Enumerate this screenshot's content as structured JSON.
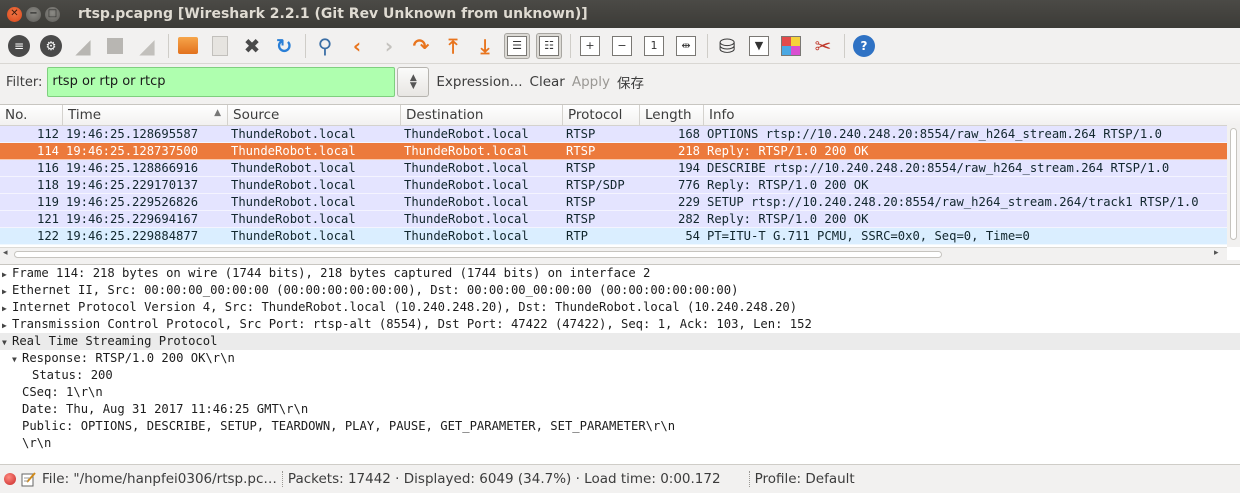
{
  "window": {
    "title": "rtsp.pcapng [Wireshark 2.2.1 (Git Rev Unknown from unknown)]"
  },
  "toolbar": {
    "icons": [
      "interfaces-icon",
      "options-icon",
      "start-capture-icon",
      "stop-capture-icon",
      "restart-capture-icon",
      "open-file-icon",
      "save-file-icon",
      "close-file-icon",
      "reload-icon",
      "find-icon",
      "go-back-icon",
      "go-forward-icon",
      "go-to-packet-icon",
      "go-first-icon",
      "go-last-icon",
      "autoscroll-icon",
      "colorize-icon",
      "zoom-in-icon",
      "zoom-out-icon",
      "normal-size-icon",
      "resize-columns-icon",
      "capture-filters-icon",
      "display-filters-icon",
      "coloring-rules-icon",
      "preferences-icon",
      "help-icon"
    ]
  },
  "filter": {
    "label": "Filter:",
    "value": "rtsp or rtp or rtcp",
    "expression": "Expression...",
    "clear": "Clear",
    "apply": "Apply",
    "save": "保存",
    "color": "#afffaf"
  },
  "packet_list": {
    "columns": [
      "No.",
      "Time",
      "Source",
      "Destination",
      "Protocol",
      "Length",
      "Info"
    ],
    "selected_color": "#ec7a3c",
    "rows": [
      {
        "no": "112",
        "time": "19:46:25.128695587",
        "src": "ThundeRobot.local",
        "dst": "ThundeRobot.local",
        "proto": "RTSP",
        "len": "168",
        "info": "OPTIONS rtsp://10.240.248.20:8554/raw_h264_stream.264 RTSP/1.0",
        "bg": "#e4e4ff",
        "selected": false
      },
      {
        "no": "114",
        "time": "19:46:25.128737500",
        "src": "ThundeRobot.local",
        "dst": "ThundeRobot.local",
        "proto": "RTSP",
        "len": "218",
        "info": "Reply: RTSP/1.0 200 OK",
        "bg": "#ec7a3c",
        "selected": true
      },
      {
        "no": "116",
        "time": "19:46:25.128866916",
        "src": "ThundeRobot.local",
        "dst": "ThundeRobot.local",
        "proto": "RTSP",
        "len": "194",
        "info": "DESCRIBE rtsp://10.240.248.20:8554/raw_h264_stream.264 RTSP/1.0",
        "bg": "#e4e4ff",
        "selected": false
      },
      {
        "no": "118",
        "time": "19:46:25.229170137",
        "src": "ThundeRobot.local",
        "dst": "ThundeRobot.local",
        "proto": "RTSP/SDP",
        "len": "776",
        "info": "Reply: RTSP/1.0 200 OK",
        "bg": "#e4e4ff",
        "selected": false
      },
      {
        "no": "119",
        "time": "19:46:25.229526826",
        "src": "ThundeRobot.local",
        "dst": "ThundeRobot.local",
        "proto": "RTSP",
        "len": "229",
        "info": "SETUP rtsp://10.240.248.20:8554/raw_h264_stream.264/track1 RTSP/1.0",
        "bg": "#e4e4ff",
        "selected": false
      },
      {
        "no": "121",
        "time": "19:46:25.229694167",
        "src": "ThundeRobot.local",
        "dst": "ThundeRobot.local",
        "proto": "RTSP",
        "len": "282",
        "info": "Reply: RTSP/1.0 200 OK",
        "bg": "#e4e4ff",
        "selected": false
      },
      {
        "no": "122",
        "time": "19:46:25.229884877",
        "src": "ThundeRobot.local",
        "dst": "ThundeRobot.local",
        "proto": "RTP",
        "len": "54",
        "info": "PT=ITU-T G.711 PCMU, SSRC=0x0, Seq=0, Time=0",
        "bg": "#daeeff",
        "selected": false
      }
    ]
  },
  "details": [
    {
      "text": "Frame 114: 218 bytes on wire (1744 bits), 218 bytes captured (1744 bits) on interface 2",
      "level": 0,
      "toggle": "collapsed",
      "hl": false
    },
    {
      "text": "Ethernet II, Src: 00:00:00_00:00:00 (00:00:00:00:00:00), Dst: 00:00:00_00:00:00 (00:00:00:00:00:00)",
      "level": 0,
      "toggle": "collapsed",
      "hl": false
    },
    {
      "text": "Internet Protocol Version 4, Src: ThundeRobot.local (10.240.248.20), Dst: ThundeRobot.local (10.240.248.20)",
      "level": 0,
      "toggle": "collapsed",
      "hl": false
    },
    {
      "text": "Transmission Control Protocol, Src Port: rtsp-alt (8554), Dst Port: 47422 (47422), Seq: 1, Ack: 103, Len: 152",
      "level": 0,
      "toggle": "collapsed",
      "hl": false
    },
    {
      "text": "Real Time Streaming Protocol",
      "level": 0,
      "toggle": "expanded",
      "hl": true
    },
    {
      "text": "Response: RTSP/1.0 200 OK\\r\\n",
      "level": 1,
      "toggle": "expanded",
      "hl": false
    },
    {
      "text": "Status: 200",
      "level": 2,
      "toggle": "none",
      "hl": false
    },
    {
      "text": "CSeq: 1\\r\\n",
      "level": 1,
      "toggle": "none",
      "hl": false
    },
    {
      "text": "Date: Thu, Aug 31 2017 11:46:25 GMT\\r\\n",
      "level": 1,
      "toggle": "none",
      "hl": false
    },
    {
      "text": "Public: OPTIONS, DESCRIBE, SETUP, TEARDOWN, PLAY, PAUSE, GET_PARAMETER, SET_PARAMETER\\r\\n",
      "level": 1,
      "toggle": "none",
      "hl": false
    },
    {
      "text": "\\r\\n",
      "level": 1,
      "toggle": "none",
      "hl": false
    }
  ],
  "status": {
    "file": "File: \"/home/hanpfei0306/rtsp.pc…",
    "packets": "Packets: 17442 · Displayed: 6049 (34.7%) · Load time: 0:00.172",
    "profile": "Profile: Default"
  }
}
